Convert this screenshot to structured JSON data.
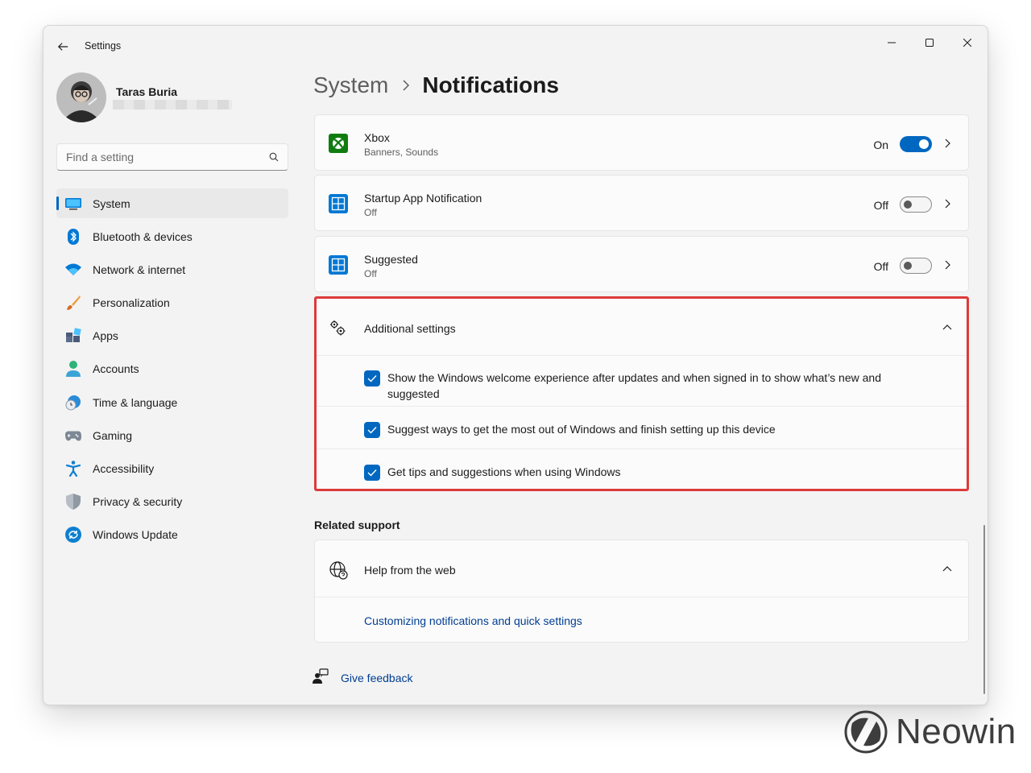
{
  "window": {
    "title": "Settings"
  },
  "user": {
    "name": "Taras Buria"
  },
  "search": {
    "placeholder": "Find a setting"
  },
  "sidebar": {
    "items": [
      {
        "label": "System",
        "icon": "monitor-icon",
        "selected": true
      },
      {
        "label": "Bluetooth & devices",
        "icon": "bluetooth-icon"
      },
      {
        "label": "Network & internet",
        "icon": "wifi-icon"
      },
      {
        "label": "Personalization",
        "icon": "brush-icon"
      },
      {
        "label": "Apps",
        "icon": "apps-icon"
      },
      {
        "label": "Accounts",
        "icon": "person-icon"
      },
      {
        "label": "Time & language",
        "icon": "globe-clock-icon"
      },
      {
        "label": "Gaming",
        "icon": "gamepad-icon"
      },
      {
        "label": "Accessibility",
        "icon": "accessibility-icon"
      },
      {
        "label": "Privacy & security",
        "icon": "shield-icon"
      },
      {
        "label": "Windows Update",
        "icon": "update-icon"
      }
    ]
  },
  "breadcrumb": {
    "parent": "System",
    "current": "Notifications"
  },
  "apps": [
    {
      "title": "Xbox",
      "subtitle": "Banners, Sounds",
      "state": "On",
      "enabled": true,
      "icon": "xbox-icon"
    },
    {
      "title": "Startup App Notification",
      "subtitle": "Off",
      "state": "Off",
      "enabled": false,
      "icon": "app-tile-icon"
    },
    {
      "title": "Suggested",
      "subtitle": "Off",
      "state": "Off",
      "enabled": false,
      "icon": "app-tile-icon"
    }
  ],
  "additional": {
    "title": "Additional settings",
    "options": [
      {
        "label": "Show the Windows welcome experience after updates and when signed in to show what’s new and suggested",
        "checked": true
      },
      {
        "label": "Suggest ways to get the most out of Windows and finish setting up this device",
        "checked": true
      },
      {
        "label": "Get tips and suggestions when using Windows",
        "checked": true
      }
    ]
  },
  "related": {
    "heading": "Related support",
    "help_title": "Help from the web",
    "link": "Customizing notifications and quick settings"
  },
  "feedback": {
    "label": "Give feedback"
  },
  "watermark": {
    "text": "Neowin"
  },
  "colors": {
    "accent": "#0067c0",
    "highlight": "#dd3a3a",
    "xbox": "#107c10"
  }
}
